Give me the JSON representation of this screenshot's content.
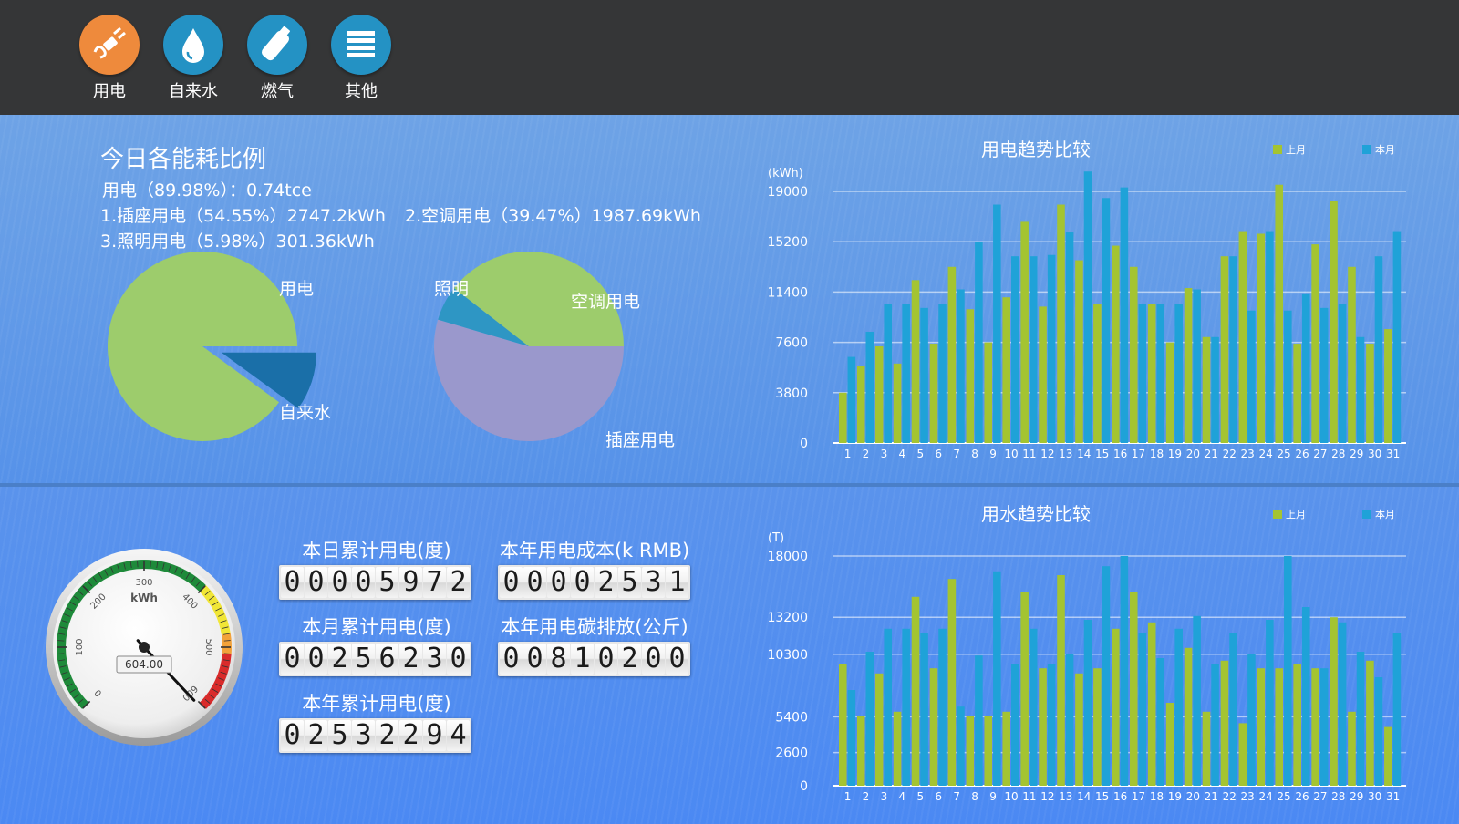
{
  "nav": {
    "items": [
      {
        "label": "用电",
        "icon": "plug-icon",
        "color": "#ee8a3c"
      },
      {
        "label": "自来水",
        "icon": "water-drop-icon",
        "color": "#2492c4"
      },
      {
        "label": "燃气",
        "icon": "gas-icon",
        "color": "#2492c4"
      },
      {
        "label": "其他",
        "icon": "menu-list-icon",
        "color": "#2492c4"
      }
    ]
  },
  "ratio": {
    "title": "今日各能耗比例",
    "line1": "用电（89.98%）：0.74tce",
    "line2a": "1.插座用电（54.55%）2747.2kWh",
    "line2b": "2.空调用电（39.47%）1987.69kWh",
    "line3": "3.照明用电（5.98%）301.36kWh",
    "pie1": {
      "labels": {
        "elec": "用电",
        "water": "自来水"
      },
      "slices": [
        {
          "name": "用电",
          "value": 89.98,
          "color": "#9dcc6c"
        },
        {
          "name": "自来水",
          "value": 10.02,
          "color": "#1a6fa8"
        }
      ]
    },
    "pie2": {
      "labels": {
        "light": "照明",
        "ac": "空调用电",
        "socket": "插座用电"
      },
      "slices": [
        {
          "name": "插座用电",
          "value": 54.55,
          "color": "#9a98cc"
        },
        {
          "name": "照明",
          "value": 5.98,
          "color": "#2e96c4"
        },
        {
          "name": "空调用电",
          "value": 39.47,
          "color": "#9dcc6c"
        }
      ]
    }
  },
  "gauge": {
    "unit": "kWh",
    "value": 604.0,
    "value_text": "604.00",
    "min": 0,
    "max": 600,
    "ticks": [
      "0",
      "100",
      "200",
      "300",
      "400",
      "500",
      "600"
    ]
  },
  "counters": [
    {
      "title": "本日累计用电(度)",
      "value": "00005972"
    },
    {
      "title": "本年用电成本(k RMB)",
      "value": "00002531"
    },
    {
      "title": "本月累计用电(度)",
      "value": "00256230"
    },
    {
      "title": "本年用电碳排放(公斤)",
      "value": "00810200"
    },
    {
      "title": "本年累计用电(度)",
      "value": "02532294"
    }
  ],
  "chart_data": [
    {
      "type": "bar",
      "title": "用电趋势比较",
      "ylabel": "(kWh)",
      "yticks": [
        0,
        3800,
        7600,
        11400,
        15200,
        19000
      ],
      "ylim": [
        0,
        19000
      ],
      "legend_position": "top-right",
      "categories": [
        "1",
        "2",
        "3",
        "4",
        "5",
        "6",
        "7",
        "8",
        "9",
        "10",
        "11",
        "12",
        "13",
        "14",
        "15",
        "16",
        "17",
        "18",
        "19",
        "20",
        "21",
        "22",
        "23",
        "24",
        "25",
        "26",
        "27",
        "28",
        "29",
        "30",
        "31"
      ],
      "series": [
        {
          "name": "上月",
          "color": "#a4c431",
          "values": [
            3800,
            5800,
            7300,
            6000,
            12300,
            7500,
            13300,
            10100,
            7600,
            11000,
            16700,
            10300,
            18000,
            13800,
            10500,
            14900,
            13300,
            10500,
            7600,
            11700,
            8000,
            14100,
            16000,
            15800,
            19500,
            7500,
            15000,
            18300,
            13300,
            7500,
            8600
          ]
        },
        {
          "name": "本月",
          "color": "#1fa2d8",
          "values": [
            6500,
            8400,
            10500,
            10500,
            10200,
            10500,
            11600,
            15200,
            18000,
            14100,
            14100,
            14200,
            15900,
            20500,
            18500,
            19300,
            10500,
            10500,
            10500,
            11600,
            8000,
            14100,
            10000,
            16000,
            10000,
            11300,
            10200,
            10500,
            8000,
            14100,
            16000
          ]
        }
      ]
    },
    {
      "type": "bar",
      "title": "用水趋势比较",
      "ylabel": "(T)",
      "yticks": [
        0,
        2600,
        5400,
        10300,
        13200,
        18000
      ],
      "ylim": [
        0,
        18000
      ],
      "legend_position": "top-right",
      "categories": [
        "1",
        "2",
        "3",
        "4",
        "5",
        "6",
        "7",
        "8",
        "9",
        "10",
        "11",
        "12",
        "13",
        "14",
        "15",
        "16",
        "17",
        "18",
        "19",
        "20",
        "21",
        "22",
        "23",
        "24",
        "25",
        "26",
        "27",
        "28",
        "29",
        "30",
        "31"
      ],
      "series": [
        {
          "name": "上月",
          "color": "#a4c431",
          "values": [
            9500,
            5500,
            8800,
            5800,
            14800,
            9200,
            16200,
            5500,
            5500,
            5800,
            15200,
            9200,
            16500,
            8800,
            9200,
            12300,
            15200,
            12800,
            6500,
            10800,
            5800,
            9800,
            4900,
            9200,
            9200,
            9500,
            9200,
            13200,
            5800,
            9800,
            4600
          ]
        },
        {
          "name": "本月",
          "color": "#1fa2d8",
          "values": [
            7500,
            10500,
            12300,
            12300,
            12000,
            12300,
            6200,
            10200,
            16800,
            9500,
            12300,
            9500,
            10300,
            13000,
            17200,
            18000,
            12000,
            10000,
            12300,
            13300,
            9500,
            12000,
            10300,
            13000,
            18000,
            14000,
            9200,
            12800,
            10500,
            8500,
            12000
          ]
        }
      ]
    }
  ]
}
